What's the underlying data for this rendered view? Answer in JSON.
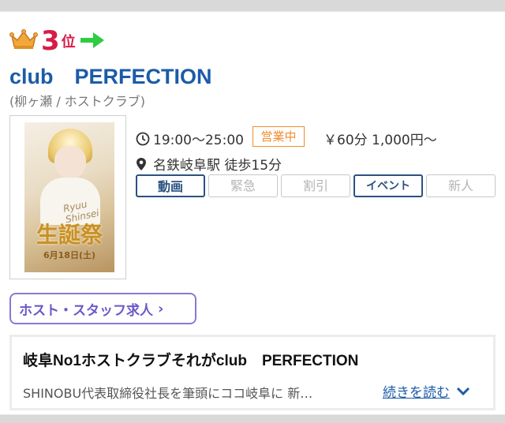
{
  "rank": {
    "number": "3",
    "unit": "位"
  },
  "club": {
    "name": "club　PERFECTION",
    "category": "(柳ヶ瀬 / ホストクラブ)"
  },
  "thumbnail": {
    "script_text": "Ryuu Shinsei",
    "banner_text": "生誕祭",
    "date_text": "6月18日(土)"
  },
  "info": {
    "hours": "19:00〜25:00",
    "status": "営業中",
    "price": "￥60分 1,000円〜",
    "station": "名鉄岐阜駅 徒歩15分"
  },
  "tags": [
    {
      "label": "動画",
      "active": true
    },
    {
      "label": "緊急",
      "active": false
    },
    {
      "label": "割引",
      "active": false
    },
    {
      "label": "イベント",
      "active": true
    },
    {
      "label": "新人",
      "active": false
    }
  ],
  "recruit_label": "ホスト・スタッフ求人",
  "intro": {
    "title": "岐阜No1ホストクラブそれがclub　PERFECTION",
    "body": "SHINOBU代表取締役社長を筆頭にココ岐阜に 新…",
    "read_more": "続きを読む"
  },
  "colors": {
    "rank_red": "#d81b47",
    "club_blue": "#1c5ba8",
    "status_orange": "#f08c2f",
    "recruit_purple": "#8b77d8",
    "arrow_green": "#2ecc40"
  }
}
